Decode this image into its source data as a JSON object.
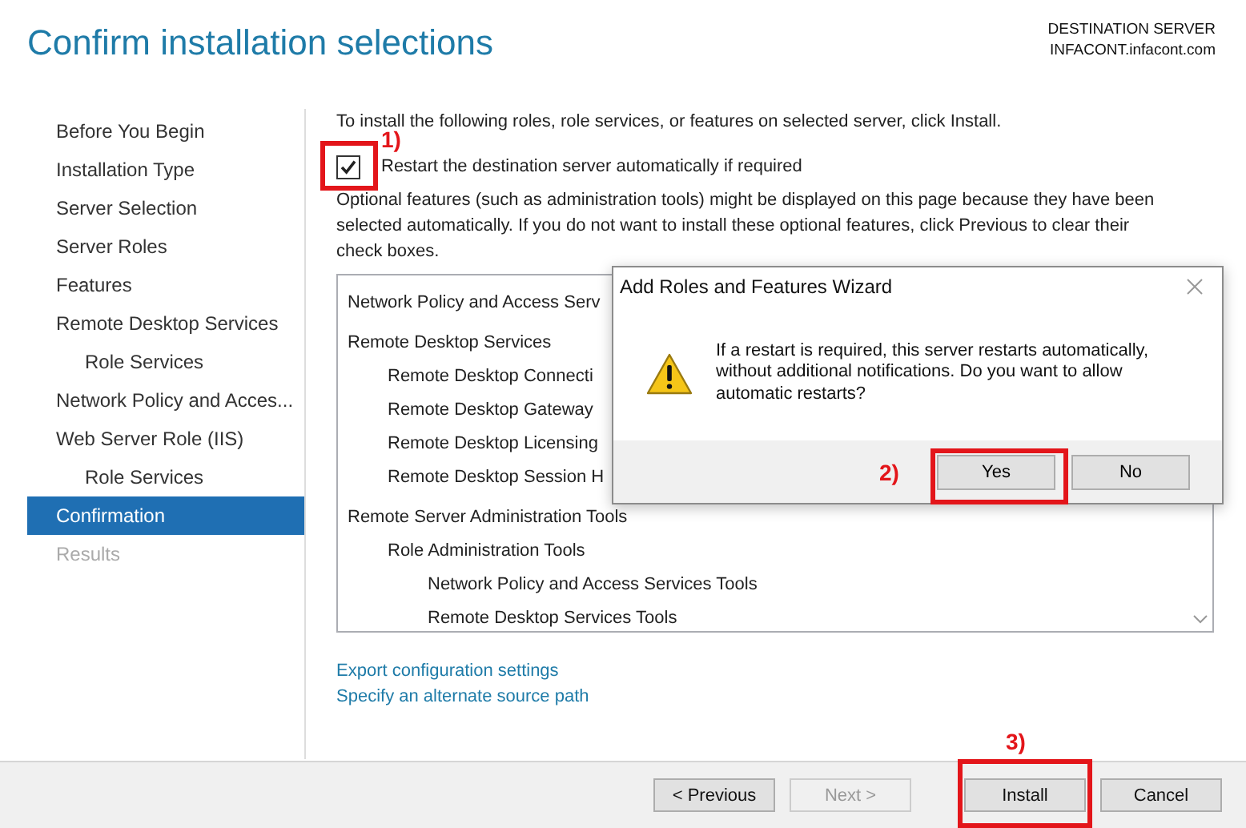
{
  "header": {
    "title": "Confirm installation selections",
    "destination_label": "DESTINATION SERVER",
    "destination_server": "INFACONT.infacont.com"
  },
  "steps": [
    {
      "label": "Before You Begin",
      "selected": false,
      "disabled": false
    },
    {
      "label": "Installation Type",
      "selected": false,
      "disabled": false
    },
    {
      "label": "Server Selection",
      "selected": false,
      "disabled": false
    },
    {
      "label": "Server Roles",
      "selected": false,
      "disabled": false
    },
    {
      "label": "Features",
      "selected": false,
      "disabled": false
    },
    {
      "label": "Remote Desktop Services",
      "selected": false,
      "disabled": false,
      "children": [
        {
          "label": "Role Services",
          "selected": false,
          "disabled": false
        }
      ]
    },
    {
      "label": "Network Policy and Acces...",
      "selected": false,
      "disabled": false
    },
    {
      "label": "Web Server Role (IIS)",
      "selected": false,
      "disabled": false,
      "children": [
        {
          "label": "Role Services",
          "selected": false,
          "disabled": false
        }
      ]
    },
    {
      "label": "Confirmation",
      "selected": true,
      "disabled": false
    },
    {
      "label": "Results",
      "selected": false,
      "disabled": true
    }
  ],
  "content": {
    "intro": "To install the following roles, role services, or features on selected server, click Install.",
    "restart_checkbox": {
      "label": "Restart the destination server automatically if required",
      "checked": true
    },
    "note": "Optional features (such as administration tools) might be displayed on this page because they have been selected automatically. If you do not want to install these optional features, click Previous to clear their check boxes.",
    "selection_list": [
      {
        "label": "Network Policy and Access Serv"
      },
      {
        "label": "Remote Desktop Services",
        "children": [
          {
            "label": "Remote Desktop Connecti"
          },
          {
            "label": "Remote Desktop Gateway"
          },
          {
            "label": "Remote Desktop Licensing"
          },
          {
            "label": "Remote Desktop Session H"
          }
        ]
      },
      {
        "label": "Remote Server Administration Tools",
        "children": [
          {
            "label": "Role Administration Tools",
            "children": [
              {
                "label": "Network Policy and Access Services Tools"
              },
              {
                "label": "Remote Desktop Services Tools"
              }
            ]
          }
        ]
      }
    ],
    "links": [
      "Export configuration settings",
      "Specify an alternate source path"
    ]
  },
  "dialog": {
    "title": "Add Roles and Features Wizard",
    "message": "If a restart is required, this server restarts automatically, without additional notifications. Do you want to allow automatic restarts?",
    "buttons": [
      "Yes",
      "No"
    ]
  },
  "footer": {
    "buttons": [
      {
        "label": "< Previous",
        "disabled": false
      },
      {
        "label": "Next >",
        "disabled": true
      },
      {
        "label": "Install",
        "disabled": false
      },
      {
        "label": "Cancel",
        "disabled": false
      }
    ]
  },
  "annotations": [
    {
      "label": "1)"
    },
    {
      "label": "2)"
    },
    {
      "label": "3)"
    }
  ]
}
